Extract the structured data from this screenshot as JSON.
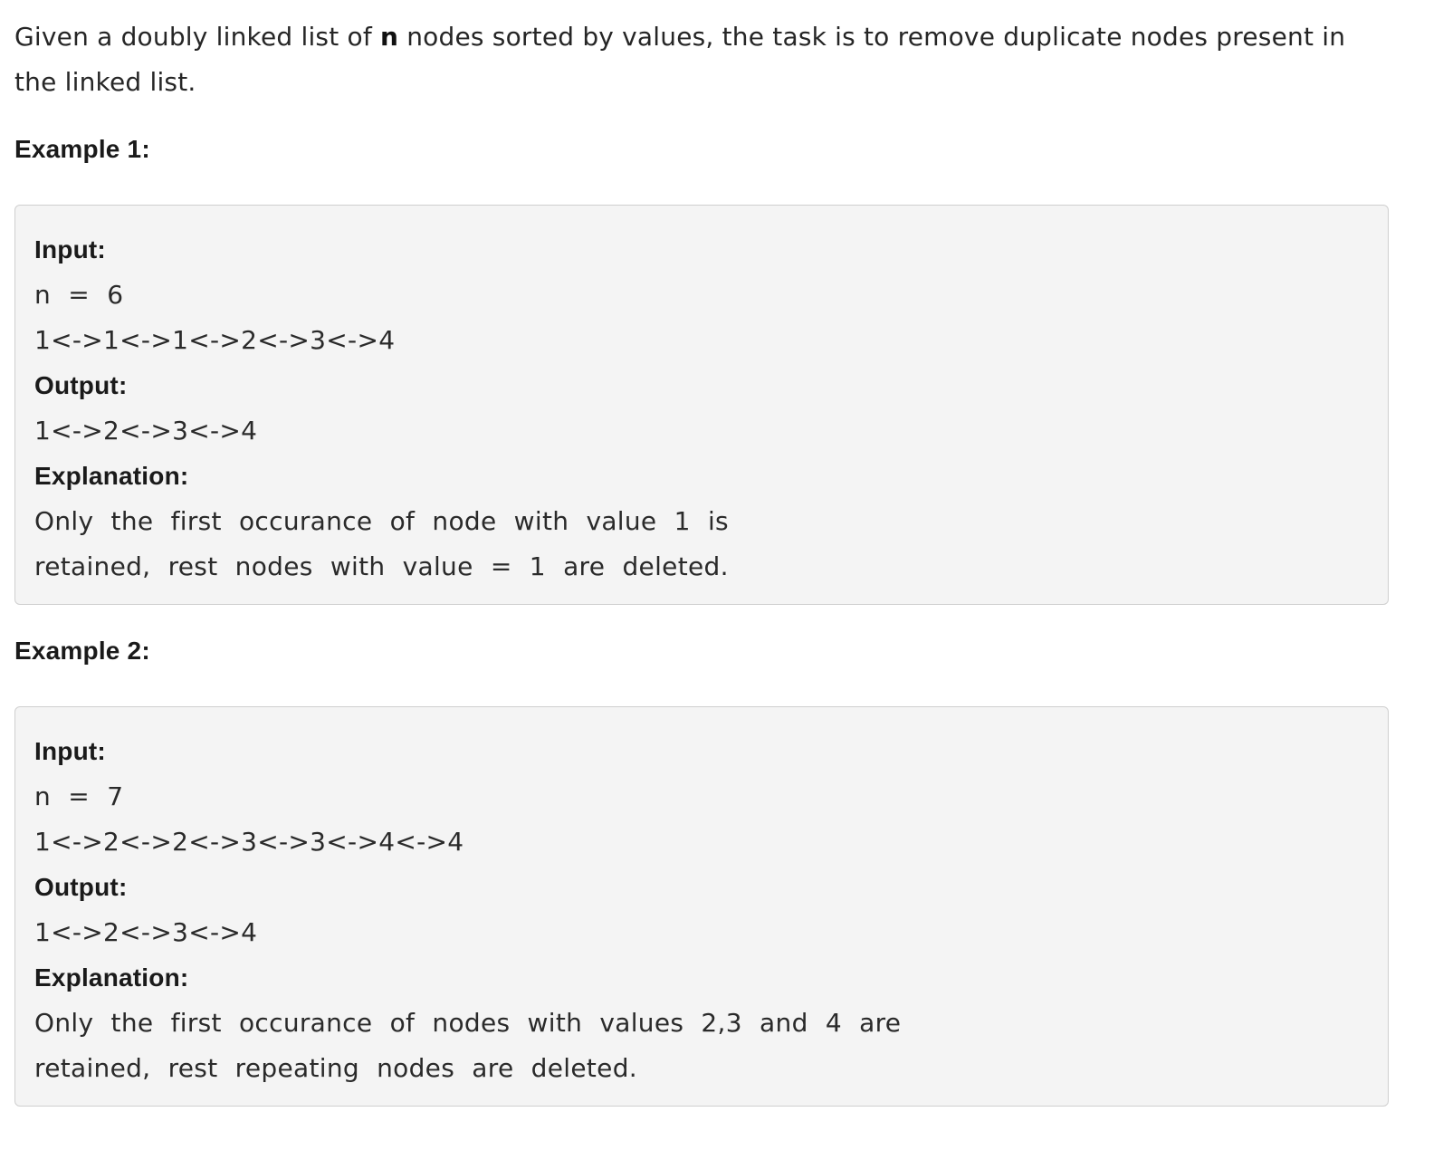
{
  "intro": {
    "before_bold": "Given a doubly linked list of ",
    "bold": "n",
    "after_bold": " nodes sorted by values, the task is to remove duplicate nodes present in the linked list."
  },
  "examples": [
    {
      "heading": "Example 1:",
      "input_label": "Input:",
      "n_line": "n = 6",
      "list_line": "1<->1<->1<->2<->3<->4",
      "output_label": "Output:",
      "output_line": "1<->2<->3<->4",
      "explanation_label": "Explanation:",
      "explanation_line1": "Only the first occurance of node with value 1 is",
      "explanation_line2": "retained, rest nodes with value = 1 are deleted."
    },
    {
      "heading": "Example 2:",
      "input_label": "Input:",
      "n_line": "n = 7",
      "list_line": "1<->2<->2<->3<->3<->4<->4",
      "output_label": "Output:",
      "output_line": "1<->2<->3<->4",
      "explanation_label": "Explanation:",
      "explanation_line1": "Only the first occurance of nodes with values 2,3 and 4 are",
      "explanation_line2": "retained, rest repeating nodes are deleted."
    }
  ]
}
